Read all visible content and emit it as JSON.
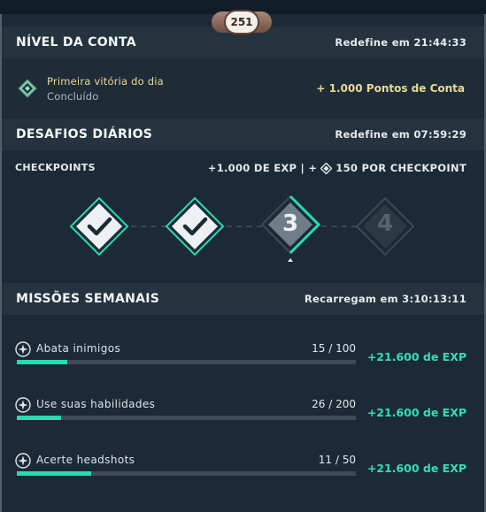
{
  "level": "251",
  "account": {
    "title": "NÍVEL DA CONTA",
    "reset": "Redefine em 21:44:33",
    "item_name": "Primeira vitória do dia",
    "item_status": "Concluído",
    "item_reward": "+ 1.000 Pontos de Conta"
  },
  "daily": {
    "title": "DESAFIOS DIÁRIOS",
    "reset": "Redefine em 07:59:29",
    "checkpoints_label": "CHECKPOINTS",
    "reward_left": "+1.000 DE EXP | +",
    "reward_right": "150 POR CHECKPOINT",
    "checkpoints": [
      {
        "state": "completed",
        "label": ""
      },
      {
        "state": "completed",
        "label": ""
      },
      {
        "state": "current",
        "label": "3"
      },
      {
        "state": "locked",
        "label": "4"
      }
    ]
  },
  "weekly": {
    "title": "MISSÕES SEMANAIS",
    "reset": "Recarregam em 3:10:13:11",
    "missions": [
      {
        "name": "Abata inimigos",
        "progress": "15 / 100",
        "fraction": 0.15,
        "reward": "+21.600 de EXP"
      },
      {
        "name": "Use suas habilidades",
        "progress": "26 / 200",
        "fraction": 0.13,
        "reward": "+21.600 de EXP"
      },
      {
        "name": "Acerte headshots",
        "progress": "11 / 50",
        "fraction": 0.22,
        "reward": "+21.600 de EXP"
      }
    ]
  },
  "colors": {
    "accent": "#2bd9b3",
    "gold": "#e9d993",
    "panel": "#1b2a36"
  }
}
